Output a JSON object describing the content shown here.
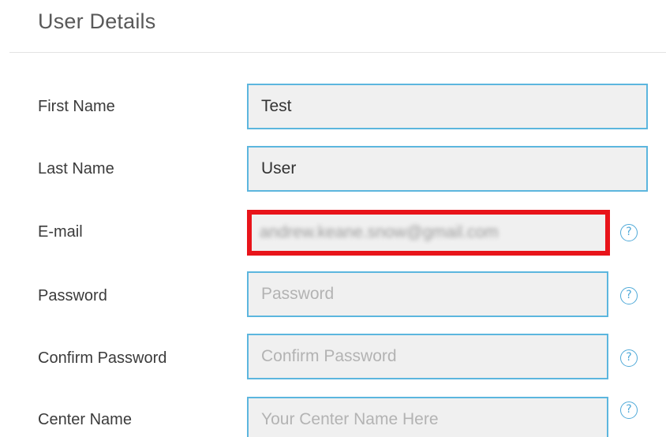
{
  "section": {
    "title": "User Details"
  },
  "fields": [
    {
      "label": "First Name",
      "value": "Test",
      "placeholder": ""
    },
    {
      "label": "Last Name",
      "value": "User",
      "placeholder": ""
    },
    {
      "label": "E-mail",
      "value": "andrew.keane.snow@gmail.com",
      "placeholder": ""
    },
    {
      "label": "Password",
      "value": "",
      "placeholder": "Password"
    },
    {
      "label": "Confirm Password",
      "value": "",
      "placeholder": "Confirm Password"
    },
    {
      "label": "Center Name",
      "value": "",
      "placeholder": "Your Center Name Here"
    }
  ],
  "help": {
    "glyph": "?"
  },
  "colors": {
    "input_border": "#5cb6de",
    "highlight_border": "#e8141a",
    "help_icon": "#4fa9d8"
  }
}
